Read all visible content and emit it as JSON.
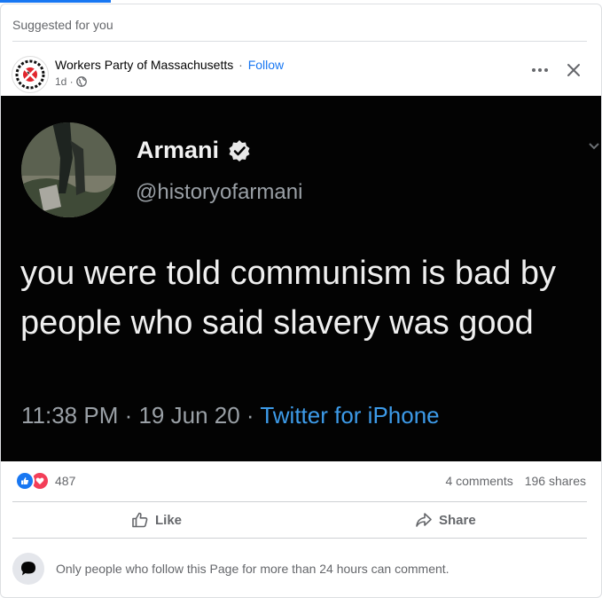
{
  "section_label": "Suggested for you",
  "post": {
    "page_name": "Workers Party of Massachusetts",
    "separator": "·",
    "follow_label": "Follow",
    "time": "1d ·",
    "logo_text": "WORKERS UNITE"
  },
  "tweet": {
    "name": "Armani",
    "handle": "@historyofarmani",
    "text": "you were told communism is bad by people who said slavery was good",
    "datetime": "11:38 PM · 19 Jun 20 · ",
    "app": "Twitter for iPhone"
  },
  "stats": {
    "reaction_count": "487",
    "comments": "4 comments",
    "shares": "196 shares"
  },
  "actions": {
    "like_label": "Like",
    "share_label": "Share"
  },
  "notice": "Only people who follow this Page for more than 24 hours can comment.",
  "colors": {
    "accent": "#1877f2",
    "love": "#f33e58",
    "tweet_link": "#3d9be9",
    "secondary_text": "#65676b"
  },
  "icons": {
    "more": "more-horizontal-icon",
    "close": "close-icon",
    "globe": "globe-icon",
    "verified": "verified-badge-icon",
    "like": "thumbs-up-icon",
    "love": "heart-icon",
    "share": "share-arrow-icon",
    "comment": "speech-bubble-icon"
  }
}
